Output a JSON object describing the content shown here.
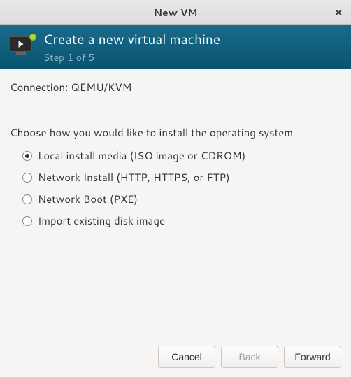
{
  "window": {
    "title": "New VM"
  },
  "header": {
    "title": "Create a new virtual machine",
    "subtitle": "Step 1 of 5"
  },
  "connection": {
    "label": "Connection:  ",
    "value": "QEMU/KVM"
  },
  "install": {
    "prompt": "Choose how you would like to install the operating system",
    "options": [
      {
        "label": "Local install media (ISO image or CDROM)",
        "selected": true
      },
      {
        "label": "Network Install (HTTP, HTTPS, or FTP)",
        "selected": false
      },
      {
        "label": "Network Boot (PXE)",
        "selected": false
      },
      {
        "label": "Import existing disk image",
        "selected": false
      }
    ]
  },
  "buttons": {
    "cancel": "Cancel",
    "back": "Back",
    "forward": "Forward"
  }
}
